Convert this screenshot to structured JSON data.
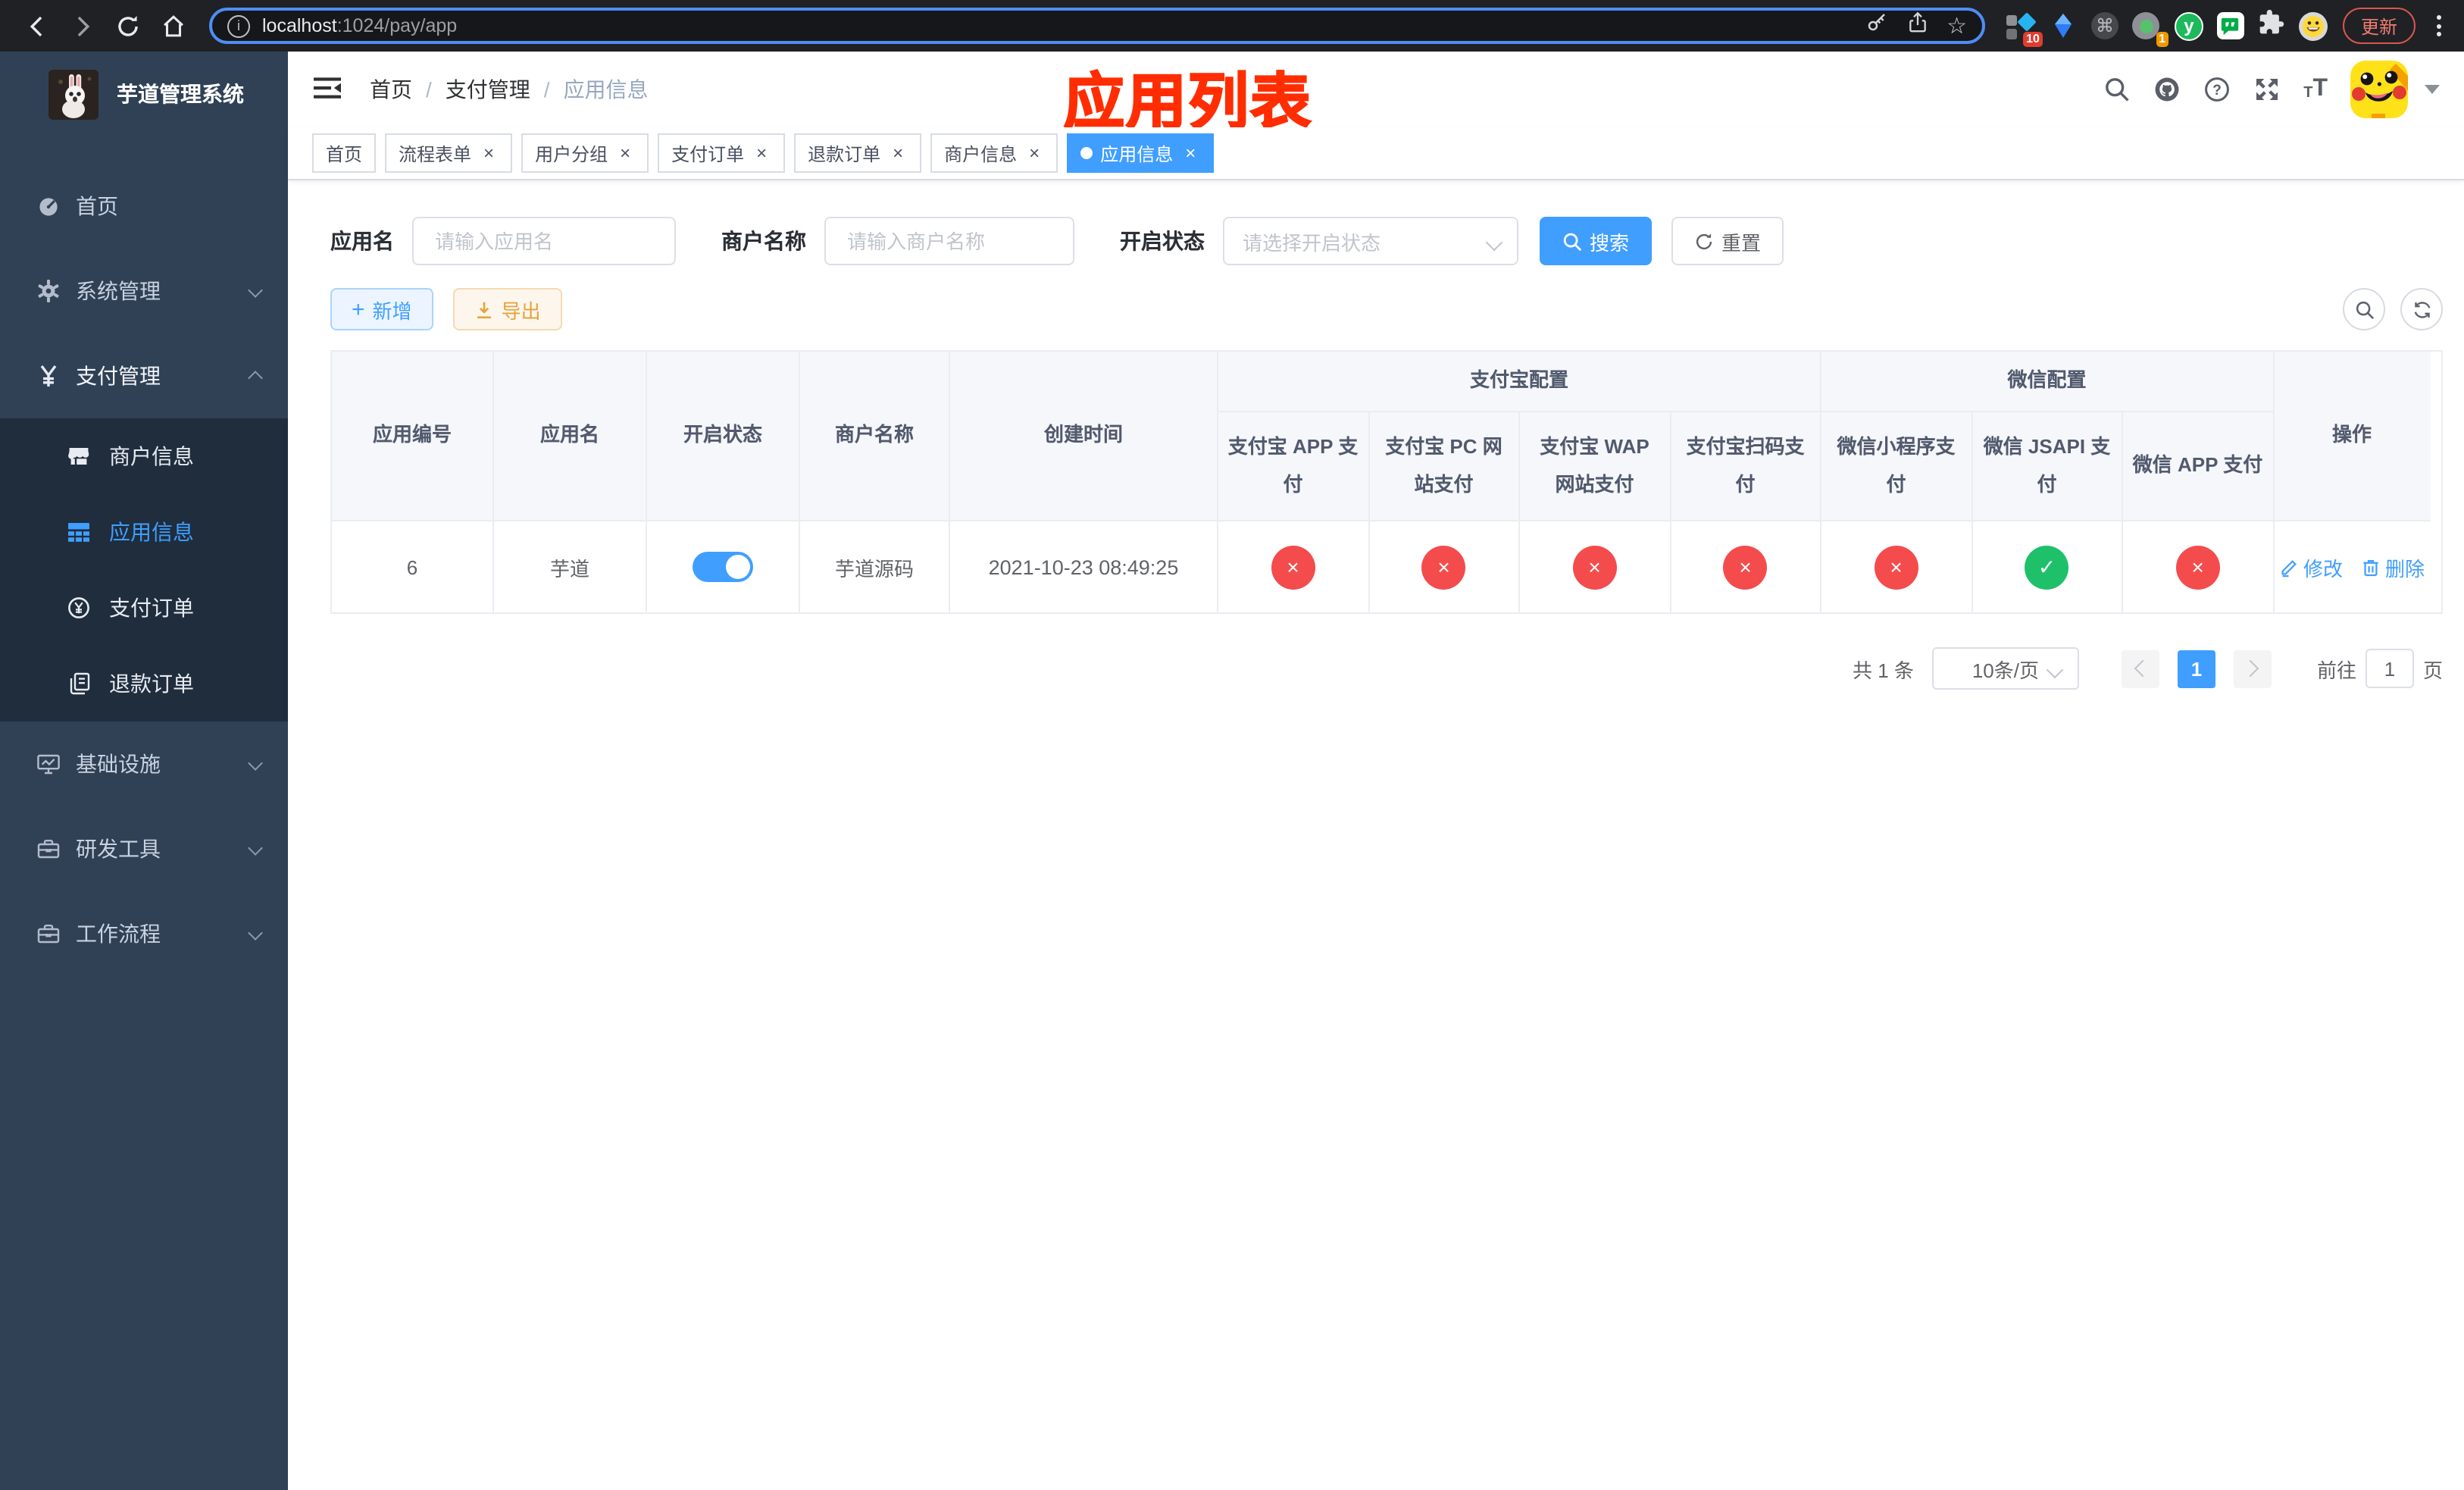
{
  "browser": {
    "url_host": "localhost",
    "url_rest": ":1024/pay/app",
    "update_label": "更新",
    "ext_badge_a": "10",
    "ext_badge_b": "1",
    "ext_letter": "y"
  },
  "sidebar": {
    "title": "芋道管理系统",
    "items": [
      {
        "label": "首页"
      },
      {
        "label": "系统管理"
      },
      {
        "label": "支付管理"
      },
      {
        "label": "商户信息"
      },
      {
        "label": "应用信息"
      },
      {
        "label": "支付订单"
      },
      {
        "label": "退款订单"
      },
      {
        "label": "基础设施"
      },
      {
        "label": "研发工具"
      },
      {
        "label": "工作流程"
      }
    ]
  },
  "navbar": {
    "breadcrumb": [
      {
        "label": "首页"
      },
      {
        "label": "支付管理"
      },
      {
        "label": "应用信息"
      }
    ],
    "overlay_title": "应用列表"
  },
  "tabs": [
    {
      "label": "首页"
    },
    {
      "label": "流程表单"
    },
    {
      "label": "用户分组"
    },
    {
      "label": "支付订单"
    },
    {
      "label": "退款订单"
    },
    {
      "label": "商户信息"
    },
    {
      "label": "应用信息"
    }
  ],
  "search": {
    "app_label": "应用名",
    "app_placeholder": "请输入应用名",
    "merchant_label": "商户名称",
    "merchant_placeholder": "请输入商户名称",
    "status_label": "开启状态",
    "status_placeholder": "请选择开启状态",
    "search_label": "搜索",
    "reset_label": "重置"
  },
  "toolbar": {
    "add_label": "新增",
    "export_label": "导出"
  },
  "table": {
    "col_id": "应用编号",
    "col_name": "应用名",
    "col_status": "开启状态",
    "col_merchant": "商户名称",
    "col_created": "创建时间",
    "col_op": "操作",
    "group_alipay": "支付宝配置",
    "group_wechat": "微信配置",
    "sub_cols": [
      "支付宝 APP 支付",
      "支付宝 PC 网站支付",
      "支付宝 WAP 网站支付",
      "支付宝扫码支付",
      "微信小程序支付",
      "微信 JSAPI 支付",
      "微信 APP 支付"
    ],
    "channel_icons": {
      "yes": "✓",
      "no": "×"
    },
    "row": {
      "id": "6",
      "name": "芋道",
      "merchant": "芋道源码",
      "created": "2021-10-23 08:49:25",
      "channels": [
        "no",
        "no",
        "no",
        "no",
        "no",
        "yes",
        "no"
      ],
      "edit_label": "修改",
      "delete_label": "删除"
    }
  },
  "pagination": {
    "total": "共 1 条",
    "page_size": "10条/页",
    "current_page": "1",
    "goto_label": "前往",
    "goto_value": "1",
    "unit_label": "页"
  },
  "colors": {
    "accent": "#409eff",
    "danger": "#f44c4c",
    "success": "#1fc06a",
    "warning": "#e6a23c"
  }
}
